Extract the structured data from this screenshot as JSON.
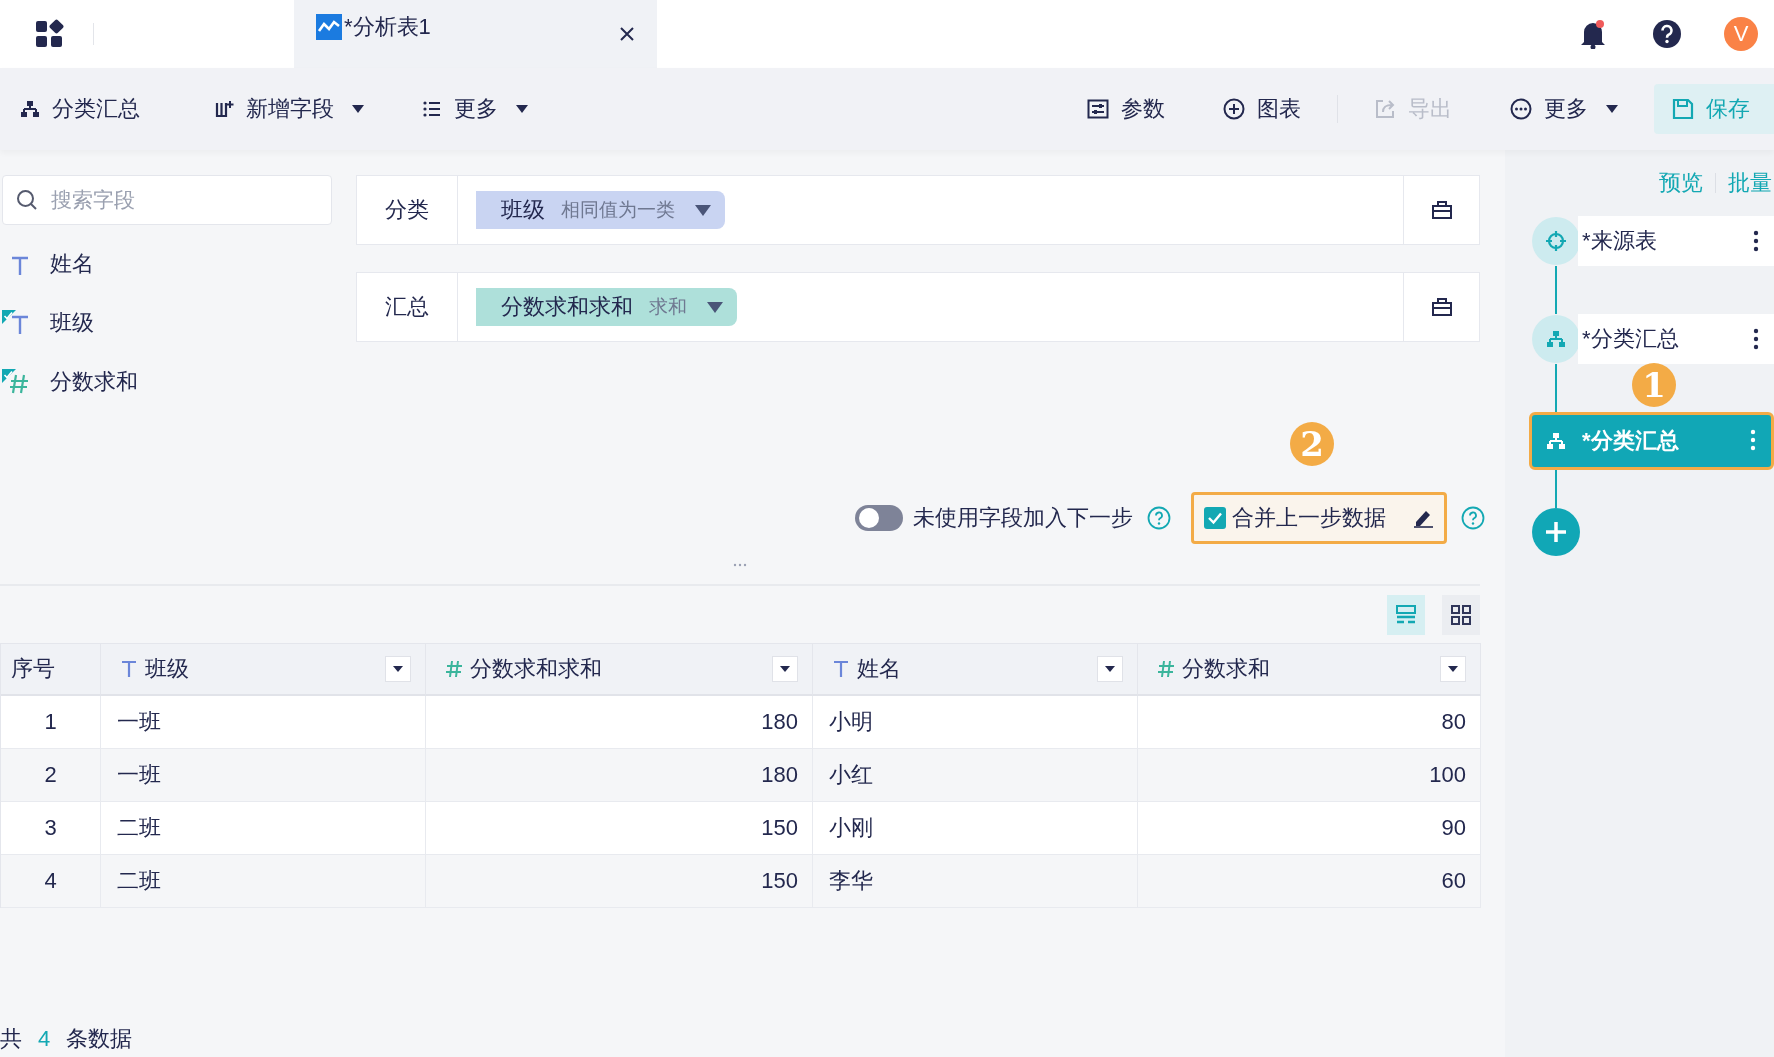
{
  "top_bar": {
    "tab": {
      "title": "*分析表1",
      "selected": true
    },
    "avatar": "V",
    "notification": true
  },
  "toolbar": {
    "left": [
      {
        "label": "分类汇总",
        "dropdown": false,
        "disabled": false
      },
      {
        "label": "新增字段",
        "dropdown": true,
        "disabled": false
      },
      {
        "label": "更多",
        "dropdown": true,
        "disabled": false
      }
    ],
    "right": [
      {
        "label": "参数",
        "dropdown": false,
        "disabled": false
      },
      {
        "label": "图表",
        "dropdown": false,
        "disabled": false
      },
      {
        "label": "导出",
        "dropdown": false,
        "disabled": true
      },
      {
        "label": "更多",
        "dropdown": true,
        "disabled": false
      }
    ],
    "save": {
      "label": "保存"
    }
  },
  "sidebar": {
    "search": {
      "placeholder": "搜索字段"
    },
    "fields": [
      {
        "name": "姓名",
        "kind": "text",
        "used": false
      },
      {
        "name": "班级",
        "kind": "text",
        "used": true
      },
      {
        "name": "分数求和",
        "kind": "number",
        "used": true
      }
    ]
  },
  "config": {
    "rows": [
      {
        "label": "分类",
        "chip": {
          "field": "班级",
          "mode": "相同值为一类",
          "color": "#c9d4f2"
        }
      },
      {
        "label": "汇总",
        "chip": {
          "field": "分数求和求和",
          "mode": "求和",
          "color": "#aee0da"
        }
      }
    ]
  },
  "options": {
    "unused_fields_toggle": {
      "label": "未使用字段加入下一步",
      "on": false
    },
    "merge_checkbox": {
      "label": "合并上一步数据",
      "checked": true
    }
  },
  "annotations": [
    {
      "number": "1"
    },
    {
      "number": "2"
    }
  ],
  "view": {
    "options": [
      {
        "selected": true
      },
      {
        "selected": false
      }
    ]
  },
  "table": {
    "columns": [
      {
        "name": "序号",
        "kind": "index"
      },
      {
        "name": "班级",
        "kind": "text"
      },
      {
        "name": "分数求和求和",
        "kind": "number"
      },
      {
        "name": "姓名",
        "kind": "text"
      },
      {
        "name": "分数求和",
        "kind": "number"
      }
    ],
    "rows": [
      [
        "1",
        "一班",
        "180",
        "小明",
        "80"
      ],
      [
        "2",
        "一班",
        "180",
        "小红",
        "100"
      ],
      [
        "3",
        "二班",
        "150",
        "小刚",
        "90"
      ],
      [
        "4",
        "二班",
        "150",
        "李华",
        "60"
      ]
    ]
  },
  "footer": {
    "prefix": "共",
    "count": "4",
    "suffix": "条数据"
  },
  "flow": {
    "links": [
      "预览",
      "批量"
    ],
    "nodes": [
      {
        "name": "*来源表",
        "kind": "source",
        "selected": false
      },
      {
        "name": "*分类汇总",
        "kind": "group",
        "selected": false
      },
      {
        "name": "*分类汇总",
        "kind": "group",
        "selected": true
      }
    ]
  }
}
